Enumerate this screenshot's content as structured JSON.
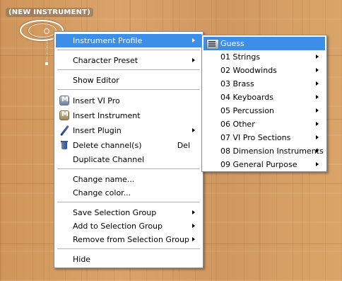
{
  "instrument": {
    "label": "(NEW INSTRUMENT)"
  },
  "main_menu": {
    "items": [
      {
        "label": "Instrument Profile",
        "submenu": true,
        "highlighted": true
      },
      {
        "label": "Character Preset",
        "submenu": true
      },
      {
        "label": "Show Editor"
      },
      {
        "label": "Insert VI Pro",
        "icon": "vi-pro-icon"
      },
      {
        "label": "Insert Instrument",
        "icon": "instrument-icon"
      },
      {
        "label": "Insert Plugin",
        "icon": "plugin-icon",
        "submenu": true
      },
      {
        "label": "Delete channel(s)",
        "icon": "trash-icon",
        "shortcut": "Del"
      },
      {
        "label": "Duplicate Channel"
      },
      {
        "label": "Change name..."
      },
      {
        "label": "Change color..."
      },
      {
        "label": "Save Selection Group",
        "submenu": true
      },
      {
        "label": "Add to Selection Group",
        "submenu": true
      },
      {
        "label": "Remove from Selection Group",
        "submenu": true
      },
      {
        "label": "Hide"
      }
    ]
  },
  "profile_submenu": {
    "items": [
      {
        "label": "Guess",
        "icon": "guess-icon",
        "highlighted": true
      },
      {
        "label": "01 Strings",
        "submenu": true
      },
      {
        "label": "02 Woodwinds",
        "submenu": true
      },
      {
        "label": "03 Brass",
        "submenu": true
      },
      {
        "label": "04 Keyboards",
        "submenu": true
      },
      {
        "label": "05 Percussion",
        "submenu": true
      },
      {
        "label": "06 Other",
        "submenu": true
      },
      {
        "label": "07 VI Pro Sections",
        "submenu": true
      },
      {
        "label": "08 Dimension Instruments",
        "submenu": true
      },
      {
        "label": "09 General Purpose",
        "submenu": true
      }
    ]
  },
  "colors": {
    "highlight": "#3d8ee9",
    "menu_bg": "#ffffff",
    "separator": "#b3b3b3",
    "floor": "#d29a5c"
  }
}
